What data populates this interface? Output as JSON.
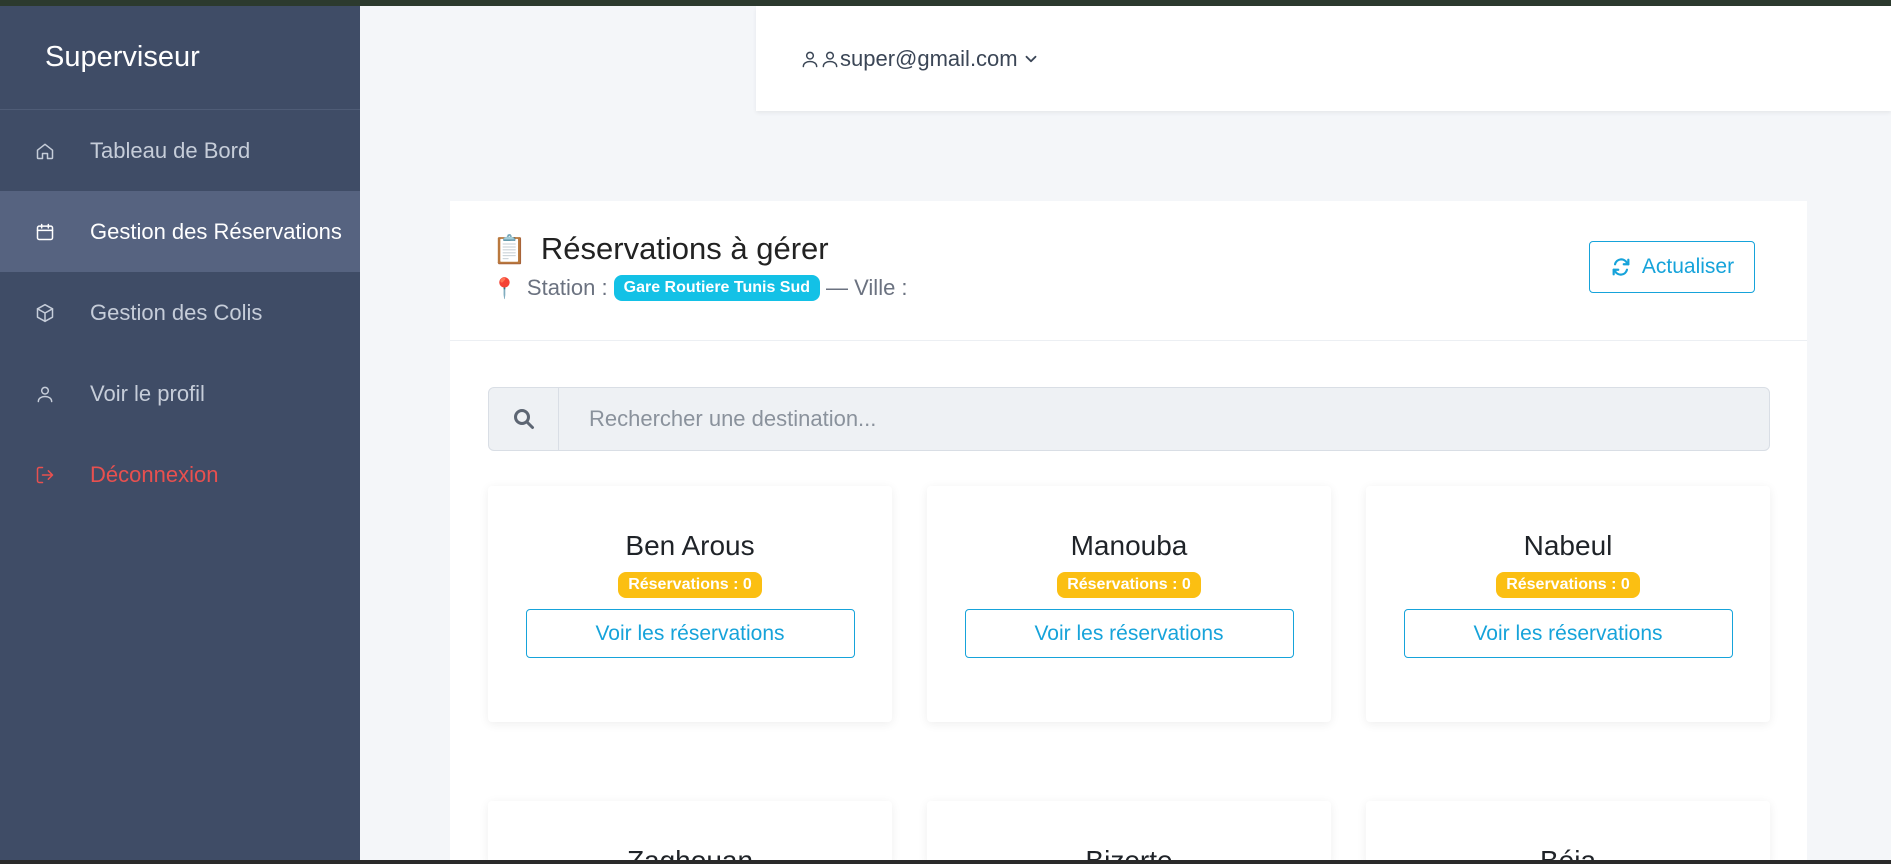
{
  "sidebar": {
    "brand": "Superviseur",
    "items": [
      {
        "label": "Tableau de Bord",
        "icon": "home-icon"
      },
      {
        "label": "Gestion des Réservations",
        "icon": "calendar-icon"
      },
      {
        "label": "Gestion des Colis",
        "icon": "box-icon"
      },
      {
        "label": "Voir le profil",
        "icon": "user-icon"
      },
      {
        "label": "Déconnexion",
        "icon": "logout-icon"
      }
    ]
  },
  "topbar": {
    "user_email": "super@gmail.com"
  },
  "main": {
    "title_emoji": "📋",
    "title": "Réservations à gérer",
    "station_label": "Station :",
    "station_name": "Gare Routiere Tunis Sud",
    "ville_label": "— Ville :",
    "refresh_label": "Actualiser",
    "search": {
      "placeholder": "Rechercher une destination..."
    },
    "cards": [
      {
        "city": "Ben Arous",
        "count": "Réservations : 0",
        "button": "Voir les réservations"
      },
      {
        "city": "Manouba",
        "count": "Réservations : 0",
        "button": "Voir les réservations"
      },
      {
        "city": "Nabeul",
        "count": "Réservations : 0",
        "button": "Voir les réservations"
      },
      {
        "city": "Zaghouan"
      },
      {
        "city": "Bizerte"
      },
      {
        "city": "Béja"
      }
    ]
  },
  "colors": {
    "sidebar_bg": "#3f4c66",
    "sidebar_active": "#566380",
    "accent": "#16a3da",
    "badge_cyan": "#13c1e6",
    "badge_warning": "#fbbf12",
    "danger": "#e8504f"
  }
}
